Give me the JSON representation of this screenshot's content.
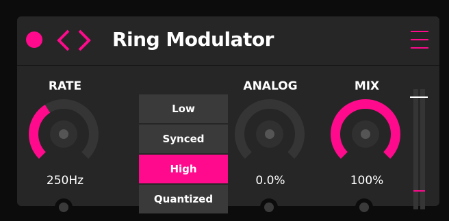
{
  "header": {
    "title": "Ring Modulator",
    "power_icon": "power-dot-icon",
    "prev_icon": "chevron-left-icon",
    "next_icon": "chevron-right-icon",
    "menu_icon": "hamburger-menu-icon"
  },
  "controls": {
    "rate": {
      "label": "RATE",
      "value": "250Hz",
      "level": 0.38
    },
    "analog": {
      "label": "ANALOG",
      "value": "0.0%",
      "level": 0.0
    },
    "mix": {
      "label": "MIX",
      "value": "100%",
      "level": 1.0
    }
  },
  "mode_selector": {
    "options": [
      "Low",
      "Synced",
      "High",
      "Quantized"
    ],
    "selected": "High"
  },
  "output_meter": {
    "level": 0.0
  },
  "colors": {
    "accent": "#ff0a8c",
    "panel": "#262626",
    "track": "#353535",
    "background": "#0c0c0c"
  }
}
